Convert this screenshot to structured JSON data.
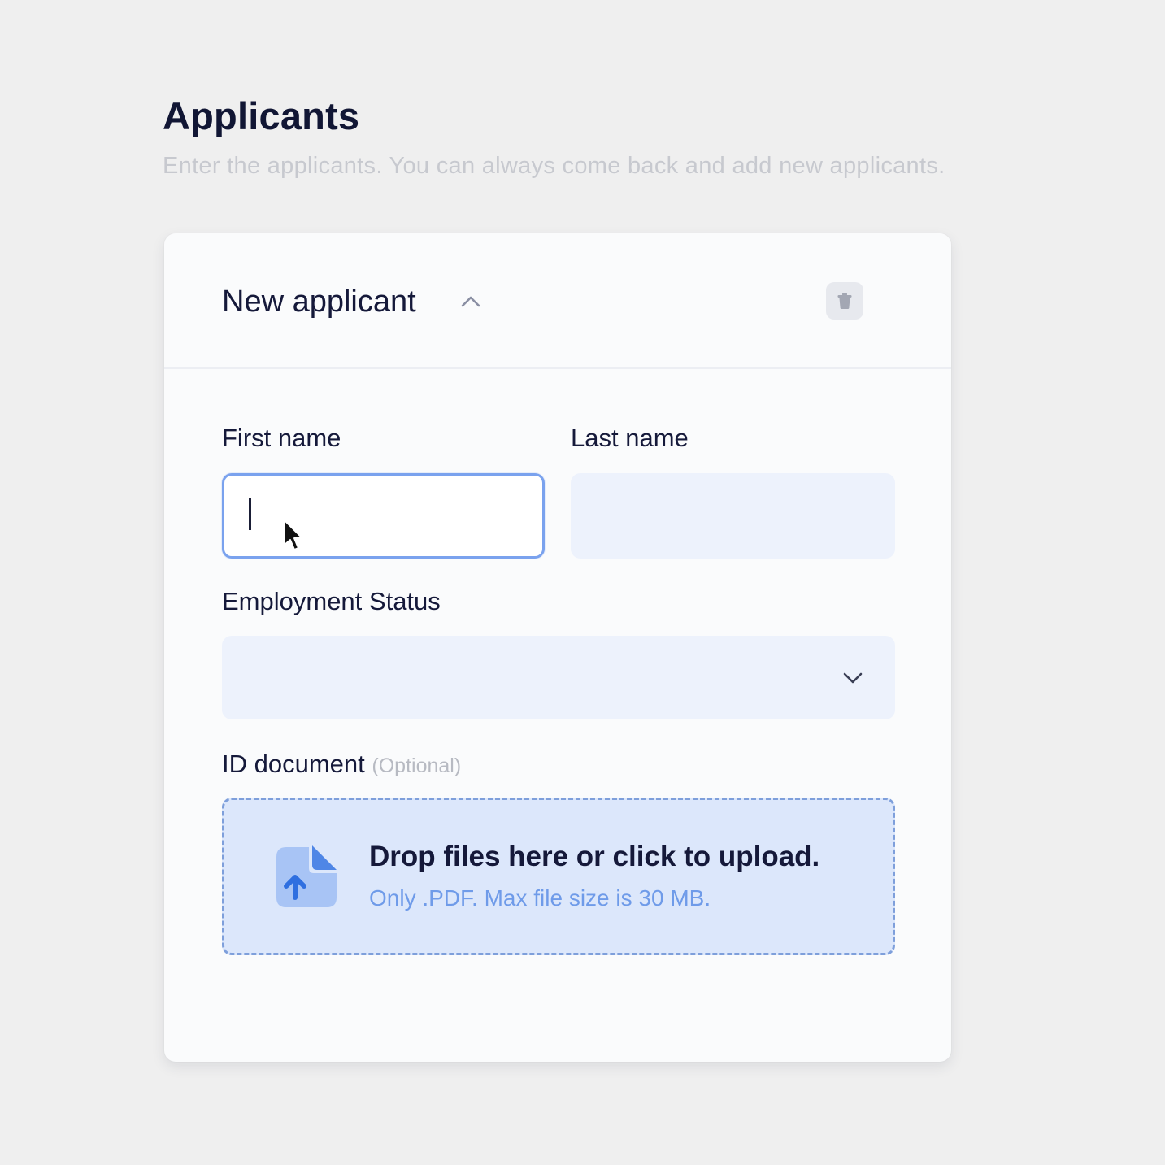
{
  "page": {
    "title": "Applicants",
    "subtitle": "Enter the applicants. You can always come back and add new applicants."
  },
  "applicant_card": {
    "title": "New applicant",
    "collapse_icon": "chevron-up-icon",
    "delete_icon": "trash-icon",
    "fields": {
      "first_name": {
        "label": "First name",
        "value": "",
        "placeholder": "",
        "focused": true
      },
      "last_name": {
        "label": "Last name",
        "value": "",
        "placeholder": ""
      },
      "employment_status": {
        "label": "Employment Status",
        "value": "",
        "dropdown_icon": "chevron-down-icon"
      },
      "id_document": {
        "label": "ID document",
        "optional_label": "(Optional)",
        "upload_icon": "file-upload-icon",
        "upload_title": "Drop files here or click to upload.",
        "upload_hint": "Only .PDF. Max file size is 30 MB."
      }
    }
  },
  "colors": {
    "background": "#efefef",
    "card": "#fafbfc",
    "heading": "#111634",
    "subtitle": "#c7c9cf",
    "input_fill": "#edf2fc",
    "focus_border": "#7aa2ee",
    "upload_fill": "#dce7fb",
    "upload_border": "#7e9fdb",
    "accent_blue": "#6f9be9"
  }
}
